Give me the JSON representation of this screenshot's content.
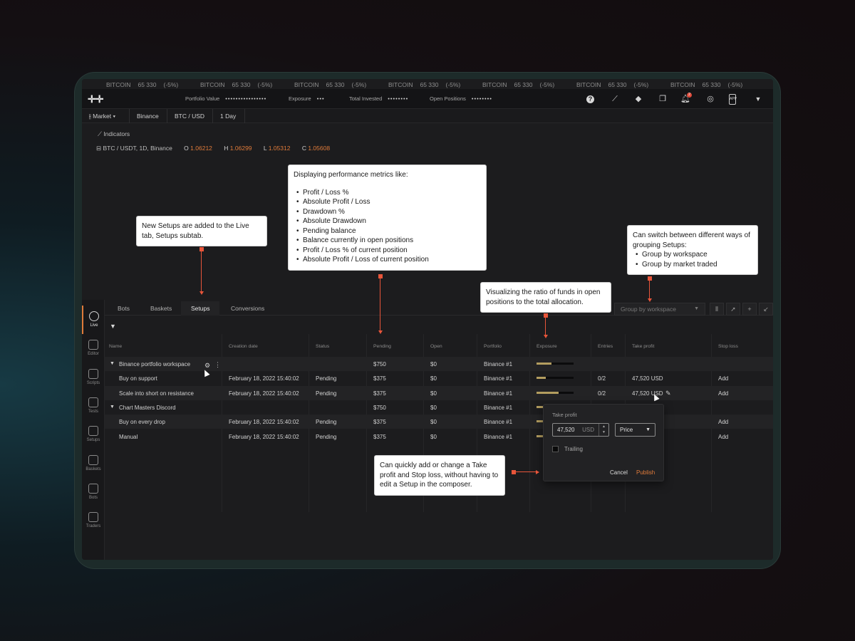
{
  "ticker": {
    "items": [
      {
        "name": "BITCOIN",
        "price": "65 330",
        "change": "(-5%)"
      },
      {
        "name": "BITCOIN",
        "price": "65 330",
        "change": "(-5%)"
      },
      {
        "name": "BITCOIN",
        "price": "65 330",
        "change": "(-5%)"
      },
      {
        "name": "BITCOIN",
        "price": "65 330",
        "change": "(-5%)"
      },
      {
        "name": "BITCOIN",
        "price": "65 330",
        "change": "(-5%)"
      },
      {
        "name": "BITCOIN",
        "price": "65 330",
        "change": "(-5%)"
      },
      {
        "name": "BITCOIN",
        "price": "65 330",
        "change": "(-5%)"
      }
    ]
  },
  "topbar": {
    "portfolio_value_label": "Portfolio Value",
    "portfolio_value": "••••••••••••••••",
    "exposure_label": "Exposure",
    "exposure": "•••",
    "total_invested_label": "Total Invested",
    "total_invested": "••••••••",
    "open_positions_label": "Open Positions",
    "open_positions": "••••••••",
    "notifications_count": "2",
    "app_label": "APP"
  },
  "subbar": {
    "market": "Market",
    "exchange": "Binance",
    "pair": "BTC / USD",
    "interval": "1 Day"
  },
  "chart": {
    "indicators_label": "Indicators",
    "symbol": "BTC / USDT, 1D, Binance",
    "o_label": "O",
    "o": "1.06212",
    "h_label": "H",
    "h": "1.06299",
    "l_label": "L",
    "l": "1.05312",
    "c_label": "C",
    "c": "1.05608"
  },
  "sidebar": [
    {
      "label": "Live",
      "icon": "live-icon"
    },
    {
      "label": "Editor",
      "icon": "editor-icon"
    },
    {
      "label": "Scripts",
      "icon": "scripts-icon"
    },
    {
      "label": "Tests",
      "icon": "tests-icon"
    },
    {
      "label": "Setups",
      "icon": "setups-icon"
    },
    {
      "label": "Baskets",
      "icon": "baskets-icon"
    },
    {
      "label": "Bots",
      "icon": "bots-icon"
    },
    {
      "label": "Traders",
      "icon": "traders-icon"
    }
  ],
  "tabs": [
    "Bots",
    "Baskets",
    "Setups",
    "Conversions"
  ],
  "group_by": {
    "value": "Group by workspace"
  },
  "table": {
    "headers": [
      "Name",
      "Creation date",
      "Status",
      "Pending",
      "Open",
      "Portfolio",
      "Exposure",
      "Entries",
      "Take profit",
      "Stop loss"
    ],
    "rows": [
      {
        "name": "Binance portfolio workspace",
        "group": true,
        "date": "",
        "status": "",
        "pending": "$750",
        "open": "$0",
        "portfolio": "Binance #1",
        "exposure": 0.4,
        "entries": "",
        "tp": "",
        "sl": ""
      },
      {
        "name": "Buy on support",
        "group": false,
        "date": "February 18, 2022 15:40:02",
        "status": "Pending",
        "pending": "$375",
        "open": "$0",
        "portfolio": "Binance #1",
        "exposure": 0.25,
        "entries": "0/2",
        "tp": "47,520 USD",
        "sl": "Add"
      },
      {
        "name": "Scale into short on resistance",
        "group": false,
        "date": "February 18, 2022 15:40:02",
        "status": "Pending",
        "pending": "$375",
        "open": "$0",
        "portfolio": "Binance #1",
        "exposure": 0.6,
        "entries": "0/2",
        "tp": "47,520 USD",
        "sl": "Add"
      },
      {
        "name": "Chart Masters Discord",
        "group": true,
        "date": "",
        "status": "",
        "pending": "$750",
        "open": "$0",
        "portfolio": "Binance #1",
        "exposure": 0.25,
        "entries": "",
        "tp": "",
        "sl": ""
      },
      {
        "name": "Buy on every drop",
        "group": false,
        "date": "February 18, 2022 15:40:02",
        "status": "Pending",
        "pending": "$375",
        "open": "$0",
        "portfolio": "Binance #1",
        "exposure": 0.25,
        "entries": "",
        "tp": "",
        "sl": "Add"
      },
      {
        "name": "Manual",
        "group": false,
        "date": "February 18, 2022 15:40:02",
        "status": "Pending",
        "pending": "$375",
        "open": "$0",
        "portfolio": "Binance #1",
        "exposure": 0.25,
        "entries": "",
        "tp": "",
        "sl": "Add"
      }
    ]
  },
  "popup": {
    "label": "Take profit",
    "value": "47,520",
    "unit": "USD",
    "type": "Price",
    "trailing": "Trailing",
    "cancel": "Cancel",
    "publish": "Publish"
  },
  "notes": {
    "setups": "New Setups are added to the Live tab, Setups subtab.",
    "metrics_title": "Displaying performance metrics like:",
    "metrics": [
      "Profit / Loss %",
      "Absolute Profit / Loss",
      "Drawdown %",
      "Absolute Drawdown",
      "Pending balance",
      "Balance currently in open positions",
      "Profit / Loss % of current position",
      "Absolute Profit / Loss of current position"
    ],
    "grouping_title": "Can switch between different ways of grouping Setups:",
    "grouping": [
      "Group by workspace",
      "Group by market traded"
    ],
    "exposure": "Visualizing the ratio of funds in open positions to the total allocation.",
    "takeprofit": "Can quickly add or change a Take profit and Stop loss, without having to edit a Setup in the composer."
  },
  "colors": {
    "accent": "#e07b3a",
    "marker": "#e8553a",
    "exposure_fill": "#b39d5f"
  }
}
